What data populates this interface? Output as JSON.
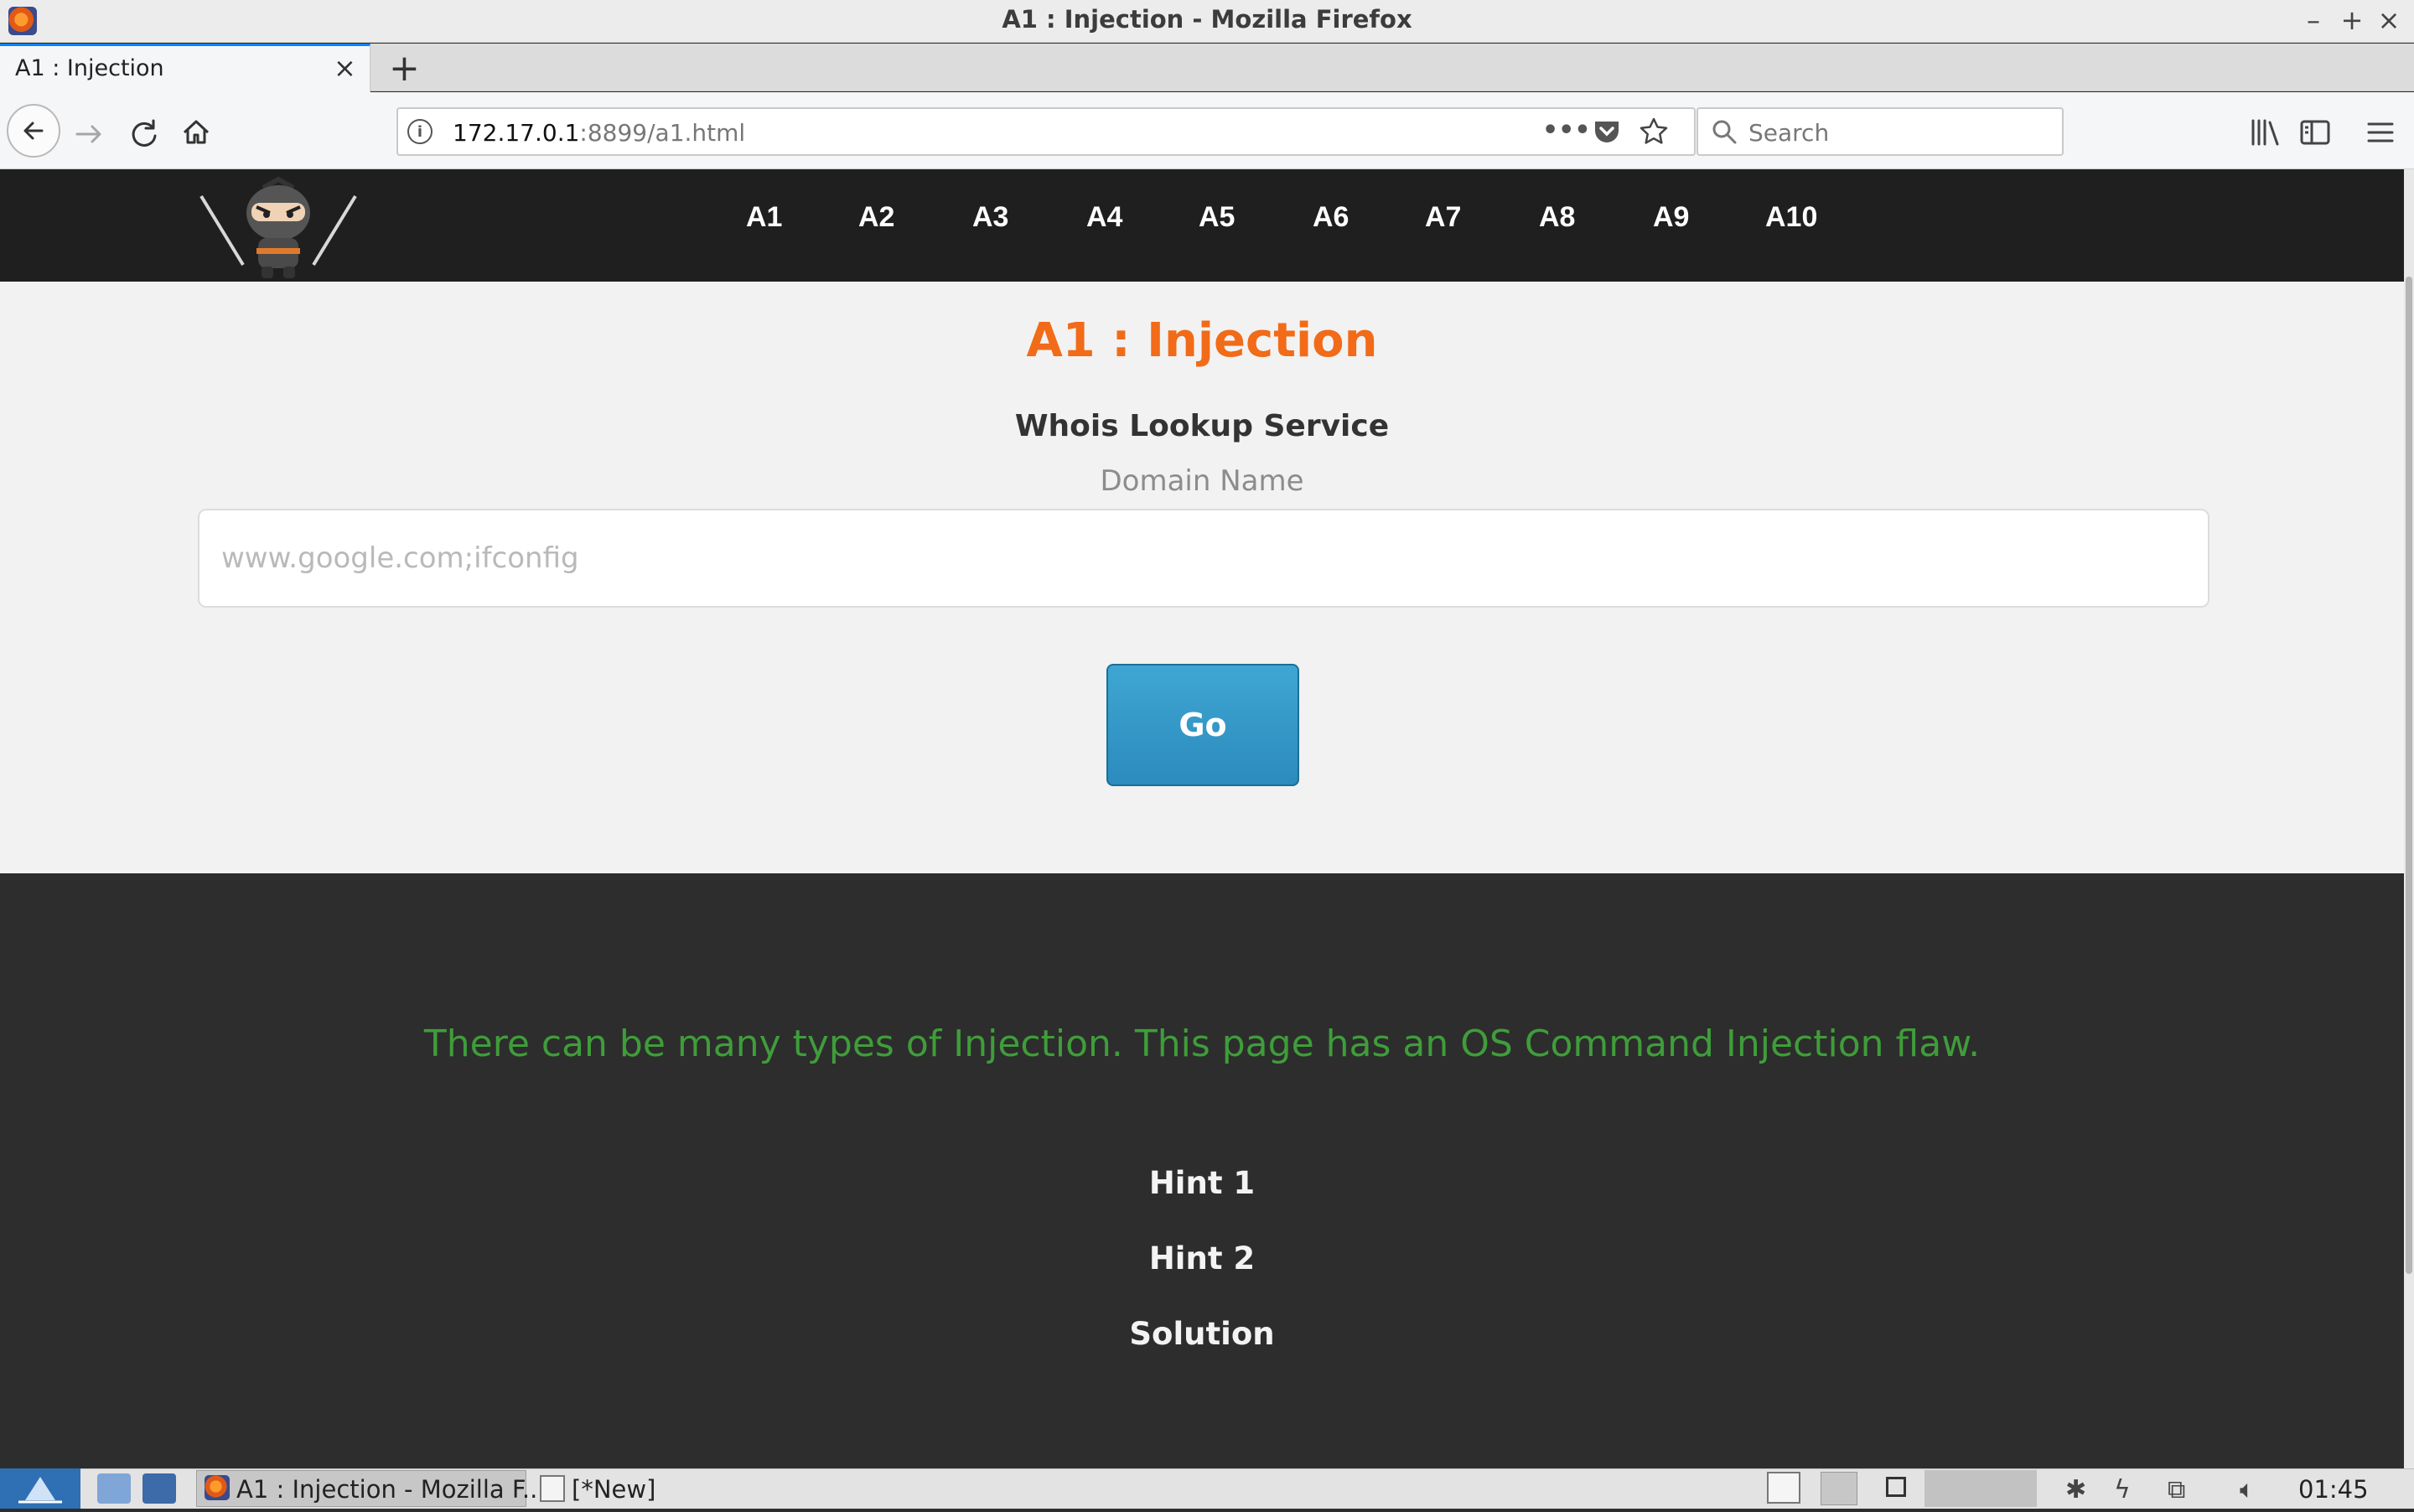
{
  "window": {
    "title": "A1 : Injection - Mozilla Firefox",
    "minimize": "–",
    "maximize": "+",
    "close": "×"
  },
  "tab": {
    "title": "A1 : Injection",
    "close": "×",
    "new_tab": "+"
  },
  "urlbar": {
    "host": "172.17.0.1",
    "path": ":8899/a1.html",
    "info": "i",
    "more": "•••"
  },
  "search": {
    "placeholder": "Search"
  },
  "site_nav": {
    "items": [
      "A1",
      "A2",
      "A3",
      "A4",
      "A5",
      "A6",
      "A7",
      "A8",
      "A9",
      "A10"
    ]
  },
  "main": {
    "title": "A1 : Injection",
    "service_title": "Whois Lookup Service",
    "field_label": "Domain Name",
    "input_placeholder": "www.google.com;ifconfig",
    "go_label": "Go"
  },
  "footer": {
    "note": "There can be many types of Injection. This page has an OS Command Injection flaw.",
    "hint1": "Hint 1",
    "hint2": "Hint 2",
    "solution": "Solution"
  },
  "taskbar": {
    "firefox_label": "A1 : Injection - Mozilla F...",
    "new_label": "[*New]",
    "clock": "01:45"
  },
  "colors": {
    "accent_orange": "#f16b18",
    "footer_green": "#3f9d3a",
    "button_blue": "#2b8bbd",
    "header_dark": "#1f1f1f"
  }
}
